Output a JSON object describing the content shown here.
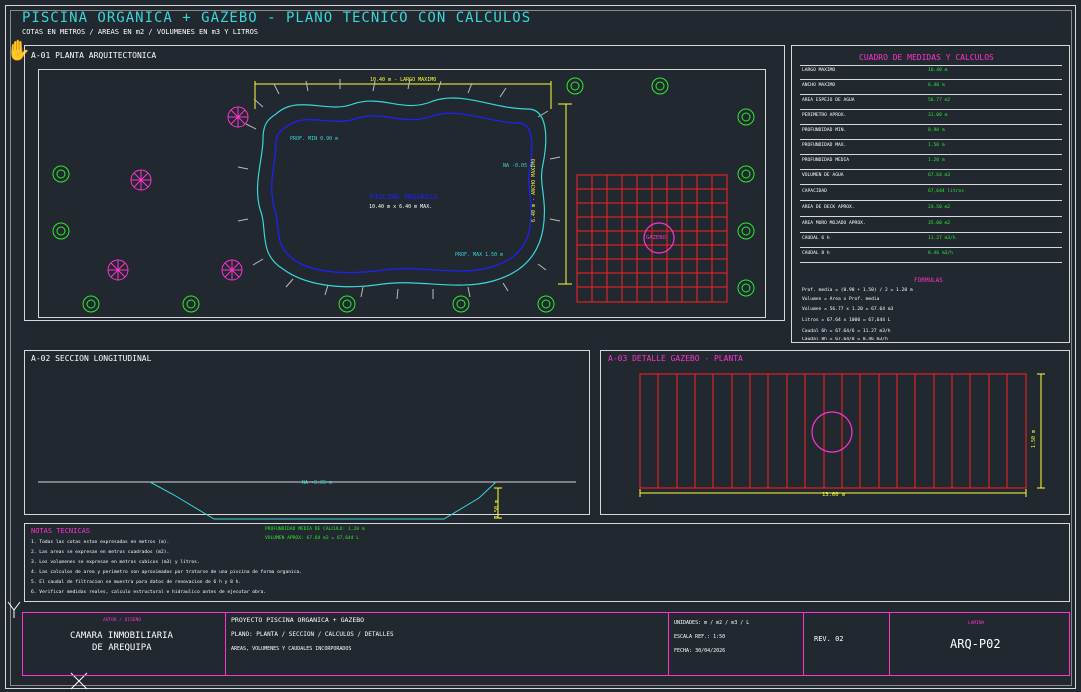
{
  "header": {
    "title": "PISCINA ORGANICA + GAZEBO - PLANO TECNICO CON CALCULOS",
    "subtitle": "COTAS EN METROS / AREAS EN m2 / VOLUMENES EN m3 Y LITROS"
  },
  "plan": {
    "label": "A-01  PLANTA ARQUITECTONICA",
    "dim_length": "10.40 m - LARGO MAXIMO",
    "dim_width": "6.40 m - ANCHO MAXIMO",
    "prof_min": "PROF. MIN 0.90 m",
    "prof_max": "PROF. MAX 1.50 m",
    "na": "NA -0.05 m",
    "pool_name": "PISCINA ORGANICA",
    "pool_dims": "10.40 m x 6.40 m MAX.",
    "gazebo_label": "GAZEBO"
  },
  "calc_table": {
    "title": "CUADRO DE MEDIDAS Y CALCULOS",
    "rows": [
      {
        "label": "LARGO MAXIMO",
        "value": "10.40 m"
      },
      {
        "label": "ANCHO MAXIMO",
        "value": "6.40 m"
      },
      {
        "label": "AREA ESPEJO DE AGUA",
        "value": "56.77 m2"
      },
      {
        "label": "PERIMETRO APROX.",
        "value": "31.00 m"
      },
      {
        "label": "PROFUNDIDAD MIN.",
        "value": "0.90 m"
      },
      {
        "label": "PROFUNDIDAD MAX.",
        "value": "1.50 m"
      },
      {
        "label": "PROFUNDIDAD MEDIA",
        "value": "1.20 m"
      },
      {
        "label": "VOLUMEN DE AGUA",
        "value": "67.64 m3"
      },
      {
        "label": "CAPACIDAD",
        "value": "67,644 litros"
      },
      {
        "label": "AREA DE DECK APROX.",
        "value": "24.50 m2"
      },
      {
        "label": "AREA MURO MOJADO APROX.",
        "value": "35.00 m2"
      },
      {
        "label": "CAUDAL 6 h",
        "value": "11.27 m3/h"
      },
      {
        "label": "CAUDAL 8 h",
        "value": "8.46 m3/h"
      }
    ],
    "formulas_title": "FORMULAS",
    "formulas": [
      "Prof. media = (0.90 + 1.50) / 2 = 1.20 m",
      "Volumen = Area x Prof. media",
      "Volumen = 56.77 x 1.20 = 67.64 m3",
      "Litros = 67.64 x 1000 = 67,644 L",
      "Caudal 6h = 67.64/6 = 11.27 m3/h",
      "Caudal 8h = 67.64/8 = 8.46 m3/h"
    ]
  },
  "section": {
    "label": "A-02  SECCION LONGITUDINAL",
    "na": "NA -0.05 m",
    "depth": "1.50 m"
  },
  "gazebo_detail": {
    "label": "A-03  DETALLE GAZEBO - PLANTA",
    "width": "13.60 m",
    "height": "1.50 m"
  },
  "notes": {
    "title": "NOTAS TECNICAS",
    "summary_1": "PROFUNDIDAD MEDIA DE CALCULO: 1.20 m",
    "summary_2": "VOLUMEN APROX: 67.64 m3 = 67,644 L",
    "items": [
      "1. Todas las cotas estan expresadas en metros (m).",
      "2. Las areas se expresan en metros cuadrados (m2).",
      "3. Los volumenes se expresan en metros cubicos (m3) y litros.",
      "4. Las calculos de area y perimetro son aproximados por tratarse de una piscina de forma organica.",
      "5. El caudal de filtracion se muestra para datos de renovacion de 6 h y 8 h.",
      "6. Verificar medidas reales, calculo estructural e hidraulico antes de ejecutar obra."
    ]
  },
  "title_block": {
    "author_label": "AUTOR / DISEÑO",
    "company_line1": "CAMARA INMOBILIARIA",
    "company_line2": "DE AREQUIPA",
    "project": "PROYECTO PISCINA ORGANICA + GAZEBO",
    "plan": "PLANO: PLANTA / SECCION / CALCULOS / DETALLES",
    "scope": "AREAS, VOLUMENES Y CAUDALES INCORPORADOS",
    "units": "UNIDADES: m / m2 / m3 / L",
    "scale": "ESCALA REF.: 1:50",
    "date": "FECHA: 30/04/2026",
    "revision": "REV. 02",
    "sheet_label": "LAMINA",
    "sheet": "ARQ-P02"
  },
  "colors": {
    "background": "#212830",
    "cyan": "#39d7d7",
    "magenta": "#ff33cc",
    "green": "#2eea2e",
    "yellow": "#ffff33",
    "red": "#ff2020",
    "blue": "#2020ff"
  }
}
